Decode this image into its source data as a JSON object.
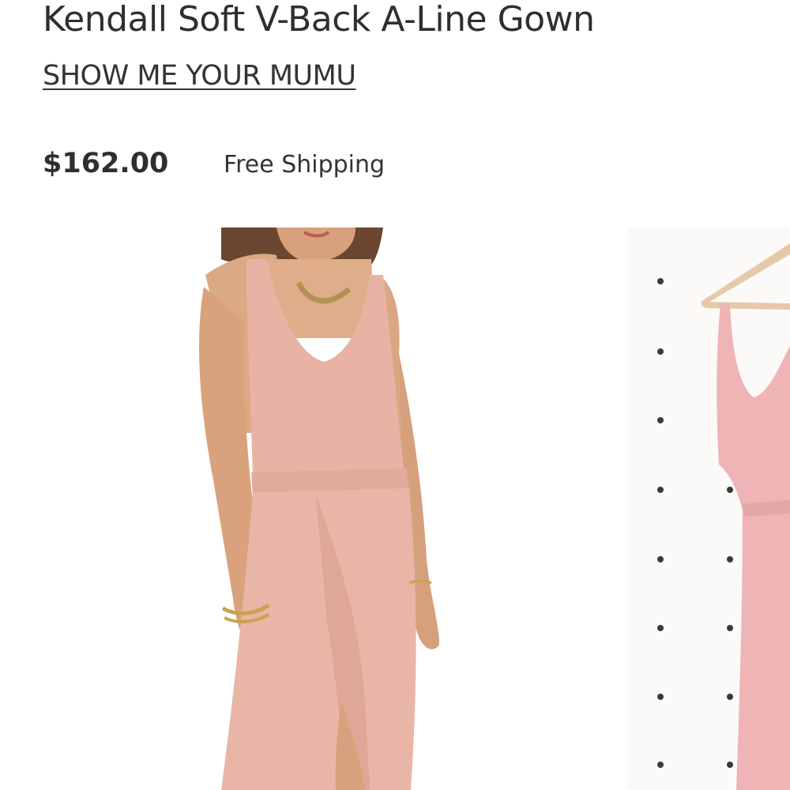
{
  "product": {
    "title": "Kendall Soft V-Back A-Line Gown",
    "brand": "SHOW ME YOUR MUMU",
    "price": "$162.00",
    "shipping": "Free Shipping"
  },
  "colors": {
    "text": "#2f2f2f",
    "dress_pink": "#e8b3a4",
    "dress_pink_hanger": "#eeb4b6",
    "skin": "#e0aa84",
    "hair": "#6b4630",
    "wall": "#fbfaf8",
    "hanger": "#e6c9a9"
  },
  "gallery": {
    "images": [
      {
        "subject": "model-wearing-gown"
      },
      {
        "subject": "gown-on-hanger"
      }
    ]
  }
}
